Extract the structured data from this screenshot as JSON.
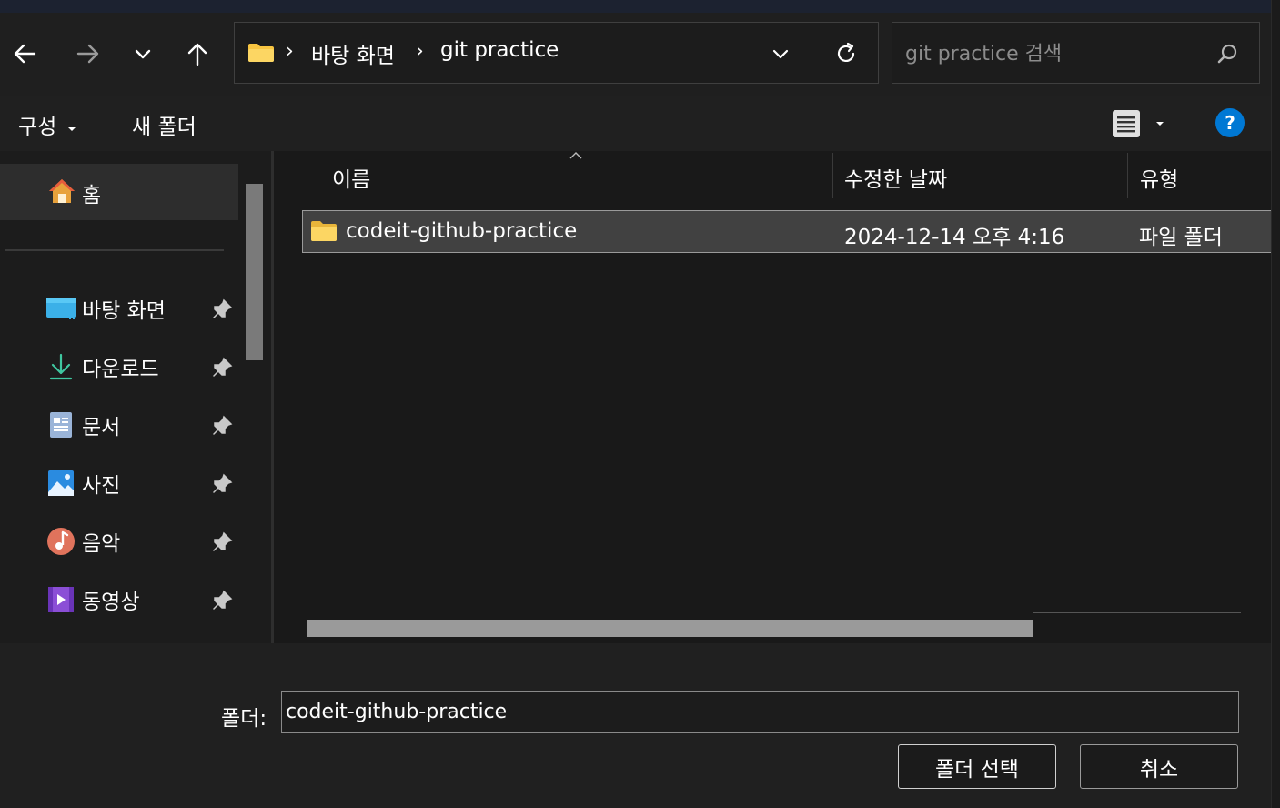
{
  "nav": {
    "back_icon": "arrow-left-icon",
    "forward_icon": "arrow-right-icon",
    "recent_icon": "chevron-down-icon",
    "up_icon": "arrow-up-icon"
  },
  "address": {
    "crumbs": [
      "바탕 화면",
      "git practice"
    ],
    "separator": "›"
  },
  "search": {
    "placeholder": "git practice 검색"
  },
  "toolbar": {
    "organize_label": "구성",
    "new_folder_label": "새 폴더",
    "help_label": "?"
  },
  "sidebar": {
    "home": {
      "label": "홈",
      "icon": "home-icon"
    },
    "items": [
      {
        "label": "바탕 화면",
        "icon": "desktop-icon"
      },
      {
        "label": "다운로드",
        "icon": "download-icon"
      },
      {
        "label": "문서",
        "icon": "documents-icon"
      },
      {
        "label": "사진",
        "icon": "pictures-icon"
      },
      {
        "label": "음악",
        "icon": "music-icon"
      },
      {
        "label": "동영상",
        "icon": "videos-icon"
      }
    ]
  },
  "file_list": {
    "columns": [
      "이름",
      "수정한 날짜",
      "유형"
    ],
    "rows": [
      {
        "name": "codeit-github-practice",
        "modified": "2024-12-14 오후 4:16",
        "type": "파일 폴더",
        "selected": true
      }
    ]
  },
  "footer": {
    "folder_label": "폴더:",
    "folder_value": "codeit-github-practice",
    "select_button": "폴더 선택",
    "cancel_button": "취소"
  },
  "colors": {
    "accent": "#0078d4",
    "folder": "#f8c541",
    "selected_row": "#414141"
  }
}
